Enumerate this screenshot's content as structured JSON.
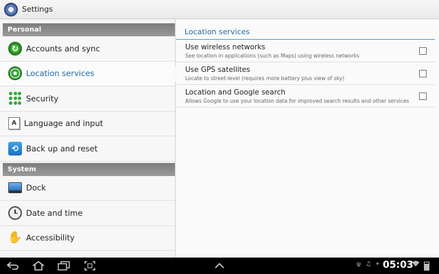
{
  "app": {
    "title": "Settings"
  },
  "sidebar": {
    "sections": [
      {
        "header": "Personal",
        "items": [
          {
            "label": "Accounts and sync",
            "icon": "sync-icon"
          },
          {
            "label": "Location services",
            "icon": "location-icon",
            "active": true
          },
          {
            "label": "Security",
            "icon": "security-icon"
          },
          {
            "label": "Language and input",
            "icon": "keyboard-icon"
          },
          {
            "label": "Back up and reset",
            "icon": "backup-icon"
          }
        ]
      },
      {
        "header": "System",
        "items": [
          {
            "label": "Dock",
            "icon": "dock-icon"
          },
          {
            "label": "Date and time",
            "icon": "clock-icon"
          },
          {
            "label": "Accessibility",
            "icon": "hand-icon"
          }
        ]
      }
    ]
  },
  "main": {
    "header": "Location services",
    "options": [
      {
        "title": "Use wireless networks",
        "description": "See location in applications (such as Maps) using wireless networks",
        "checked": false
      },
      {
        "title": "Use GPS satellites",
        "description": "Locate to street-level (requires more battery plus view of sky)",
        "checked": false
      },
      {
        "title": "Location and Google search",
        "description": "Allows Google to use your location data for improved search results and other services",
        "checked": false
      }
    ]
  },
  "statusbar": {
    "time": "05:03"
  },
  "colors": {
    "accent": "#1e6aa6",
    "section_header": "#8a8a8a",
    "navbar": "#000000"
  }
}
